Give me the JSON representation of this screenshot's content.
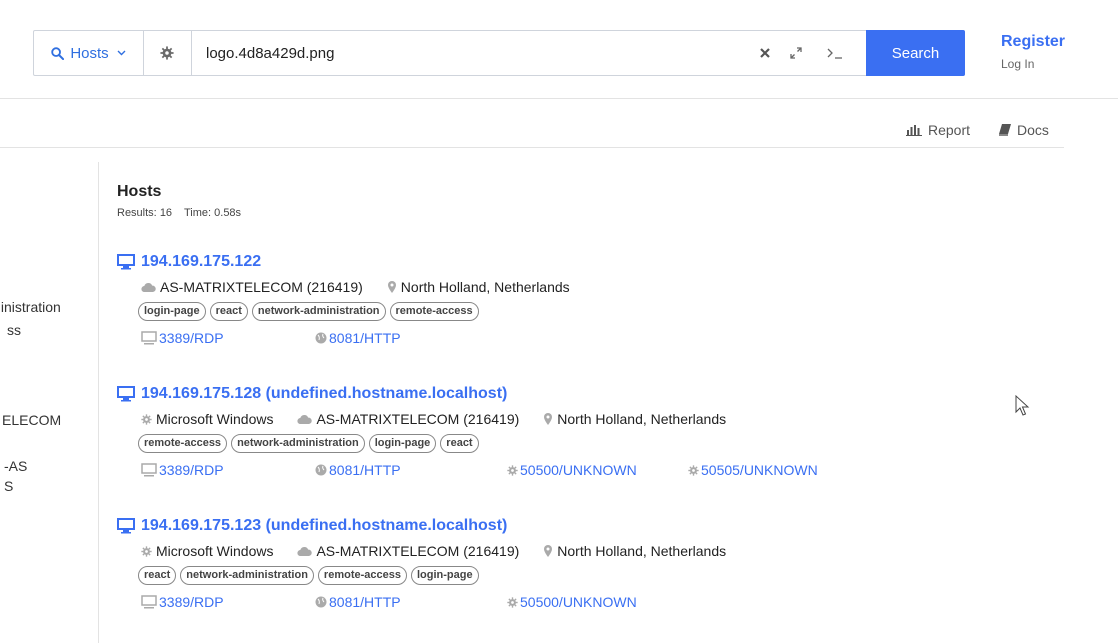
{
  "search": {
    "scope_label": "Hosts",
    "query": "logo.4d8a429d.png",
    "button_label": "Search"
  },
  "auth": {
    "register": "Register",
    "login": "Log In"
  },
  "actions": {
    "report": "Report",
    "docs": "Docs"
  },
  "sidebar_fragments": [
    ":inistration",
    "ss",
    "ELECOM",
    "-AS",
    "S"
  ],
  "results_header": {
    "title": "Hosts",
    "results_label": "Results:",
    "results_count": "16",
    "time_label": "Time:",
    "time_value": "0.58s"
  },
  "results": [
    {
      "ip": "194.169.175.122",
      "os": "",
      "asn": "AS-MATRIXTELECOM (216419)",
      "location": "North Holland, Netherlands",
      "tags": [
        "login-page",
        "react",
        "network-administration",
        "remote-access"
      ],
      "ports": [
        {
          "label": "3389/RDP",
          "icon": "monitor-icon"
        },
        {
          "label": "8081/HTTP",
          "icon": "globe-icon"
        }
      ]
    },
    {
      "ip": "194.169.175.128 (undefined.hostname.localhost)",
      "os": "Microsoft Windows",
      "asn": "AS-MATRIXTELECOM (216419)",
      "location": "North Holland, Netherlands",
      "tags": [
        "remote-access",
        "network-administration",
        "login-page",
        "react"
      ],
      "ports": [
        {
          "label": "3389/RDP",
          "icon": "monitor-icon"
        },
        {
          "label": "8081/HTTP",
          "icon": "globe-icon"
        },
        {
          "label": "50500/UNKNOWN",
          "icon": "gear-icon"
        },
        {
          "label": "50505/UNKNOWN",
          "icon": "gear-icon"
        }
      ]
    },
    {
      "ip": "194.169.175.123 (undefined.hostname.localhost)",
      "os": "Microsoft Windows",
      "asn": "AS-MATRIXTELECOM (216419)",
      "location": "North Holland, Netherlands",
      "tags": [
        "react",
        "network-administration",
        "remote-access",
        "login-page"
      ],
      "ports": [
        {
          "label": "3389/RDP",
          "icon": "monitor-icon"
        },
        {
          "label": "8081/HTTP",
          "icon": "globe-icon"
        },
        {
          "label": "50500/UNKNOWN",
          "icon": "gear-icon"
        }
      ]
    }
  ],
  "colors": {
    "accent": "#3a6ff2",
    "border": "#cfd4dc",
    "muted": "#aaaaaa"
  }
}
